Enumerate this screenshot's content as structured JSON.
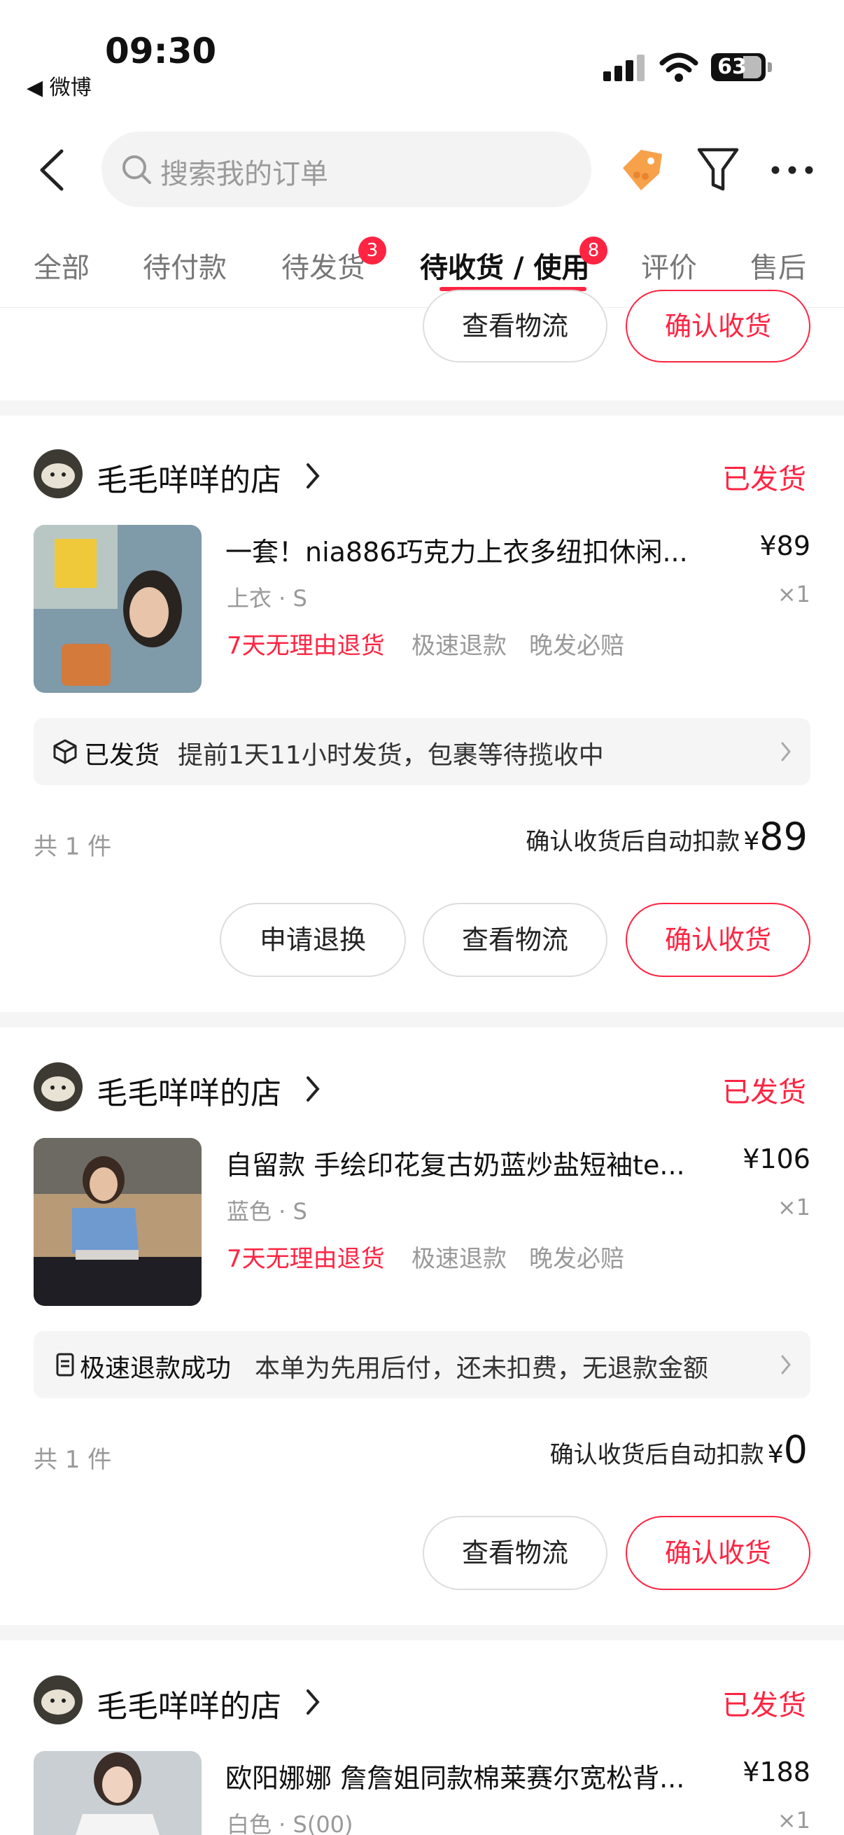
{
  "status_bar": {
    "time": "09:30",
    "back_app": "◀ 微博",
    "battery": "63"
  },
  "search": {
    "placeholder": "搜索我的订单"
  },
  "icons": {
    "back": "chevron-left-icon",
    "coupon": "coupon-tag-icon",
    "filter": "filter-icon",
    "more": "more-dots-icon"
  },
  "tabs": [
    {
      "label": "全部"
    },
    {
      "label": "待付款"
    },
    {
      "label": "待发货",
      "badge": "3"
    },
    {
      "label": "待收货 / 使用",
      "badge": "8",
      "active": true
    },
    {
      "label": "评价"
    },
    {
      "label": "售后"
    }
  ],
  "colors": {
    "accent": "#ff2442",
    "page_bg": "#f5f5f5"
  },
  "partial_order": {
    "buttons": [
      "查看物流",
      "确认收货"
    ]
  },
  "orders": [
    {
      "shop": "毛毛咩咩的店",
      "status": "已发货",
      "item_title": "一套！nia886巧克力上衣多纽扣休闲...",
      "price": "¥89",
      "spec": "上衣 · S",
      "qty": "×1",
      "tags": [
        "7天无理由退货",
        "极速退款",
        "晚发必赔"
      ],
      "info_strong": "已发货",
      "info_text": "提前1天11小时发货，包裹等待揽收中",
      "count": "共 1 件",
      "total_label": "确认收货后自动扣款",
      "total_currency": "¥",
      "total_amount": "89",
      "buttons": [
        "申请退换",
        "查看物流",
        "确认收货"
      ]
    },
    {
      "shop": "毛毛咩咩的店",
      "status": "已发货",
      "item_title": "自留款 手绘印花复古奶蓝炒盐短袖te...",
      "price": "¥106",
      "spec": "蓝色 · S",
      "qty": "×1",
      "tags": [
        "7天无理由退货",
        "极速退款",
        "晚发必赔"
      ],
      "info_strong": "极速退款成功",
      "info_text": "本单为先用后付，还未扣费，无退款金额",
      "count": "共 1 件",
      "total_label": "确认收货后自动扣款",
      "total_currency": "¥",
      "total_amount": "0",
      "buttons": [
        "查看物流",
        "确认收货"
      ]
    },
    {
      "shop": "毛毛咩咩的店",
      "status": "已发货",
      "item_title": "欧阳娜娜 詹詹姐同款棉莱赛尔宽松背...",
      "price": "¥188",
      "spec": "白色 · S(00)",
      "qty": "×1"
    }
  ]
}
